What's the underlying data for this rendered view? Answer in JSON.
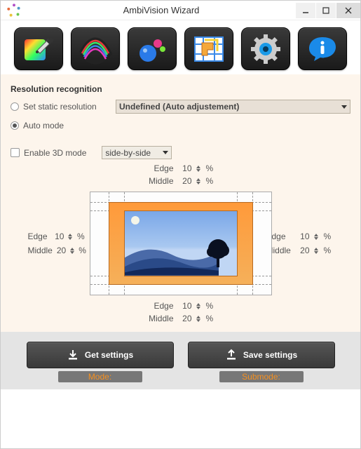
{
  "title": "AmbiVision Wizard",
  "resolution": {
    "title": "Resolution recognition",
    "static_label": "Set static resolution",
    "auto_label": "Auto mode",
    "select_value": "Undefined (Auto adjustement)"
  },
  "threeD": {
    "enable_label": "Enable 3D mode",
    "mode_value": "side-by-side"
  },
  "edges": {
    "edge_label": "Edge",
    "middle_label": "Middle",
    "pct": "%",
    "top": {
      "edge": "10",
      "middle": "20"
    },
    "bottom": {
      "edge": "10",
      "middle": "20"
    },
    "left": {
      "edge": "10",
      "middle": "20"
    },
    "right": {
      "edge": "10",
      "middle": "20"
    }
  },
  "footer": {
    "get_label": "Get settings",
    "save_label": "Save settings",
    "mode_label": "Mode:",
    "submode_label": "Submode:"
  }
}
